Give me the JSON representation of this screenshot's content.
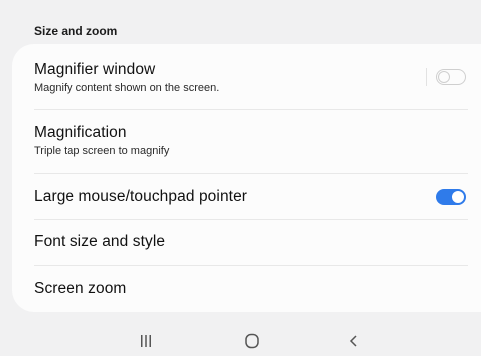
{
  "section": {
    "title": "Size and zoom"
  },
  "items": [
    {
      "title": "Magnifier window",
      "subtitle": "Magnify content shown on the screen.",
      "toggle": "off"
    },
    {
      "title": "Magnification",
      "subtitle": "Triple tap screen to magnify"
    },
    {
      "title": "Large mouse/touchpad pointer",
      "toggle": "on"
    },
    {
      "title": "Font size and style"
    },
    {
      "title": "Screen zoom"
    }
  ],
  "colors": {
    "accent": "#2f7bea",
    "background": "#f1f1f2",
    "card": "#fcfcfc"
  },
  "navbar": {
    "recents_icon": "recent-apps-icon",
    "home_icon": "home-icon",
    "back_icon": "back-icon"
  }
}
